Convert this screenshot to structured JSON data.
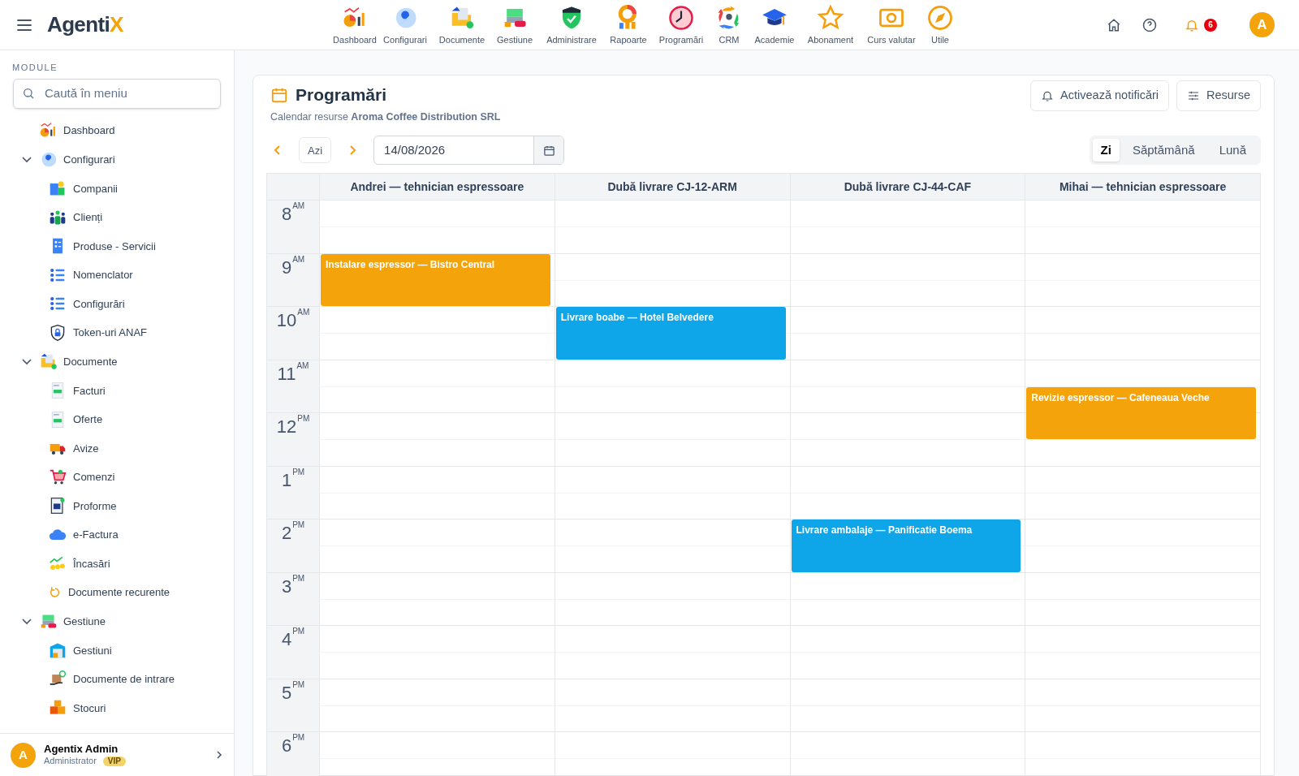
{
  "header": {
    "logo": {
      "text": "Agenti",
      "accent": "X"
    },
    "nav": [
      {
        "label": "Dashboard"
      },
      {
        "label": "Configurari"
      },
      {
        "label": "Documente"
      },
      {
        "label": "Gestiune"
      },
      {
        "label": "Administrare"
      },
      {
        "label": "Rapoarte"
      },
      {
        "label": "Programări"
      },
      {
        "label": "CRM"
      },
      {
        "label": "Academie"
      },
      {
        "label": "Abonament"
      },
      {
        "label": "Curs valutar"
      },
      {
        "label": "Utile"
      }
    ],
    "notifications": "6",
    "avatar": "A"
  },
  "sidebar": {
    "section": "MODULE",
    "search": {
      "placeholder": "Caută în meniu"
    },
    "items": [
      {
        "label": "Dashboard"
      },
      {
        "label": "Configurari",
        "expanded": true,
        "children": [
          {
            "label": "Companii"
          },
          {
            "label": "Clienți"
          },
          {
            "label": "Produse - Servicii"
          },
          {
            "label": "Nomenclator"
          },
          {
            "label": "Configurări"
          },
          {
            "label": "Token-uri ANAF"
          }
        ]
      },
      {
        "label": "Documente",
        "expanded": true,
        "children": [
          {
            "label": "Facturi"
          },
          {
            "label": "Oferte"
          },
          {
            "label": "Avize"
          },
          {
            "label": "Comenzi"
          },
          {
            "label": "Proforme"
          },
          {
            "label": "e-Factura"
          },
          {
            "label": "Încasări"
          },
          {
            "label": "Documente recurente"
          }
        ]
      },
      {
        "label": "Gestiune",
        "expanded": true,
        "children": [
          {
            "label": "Gestiuni"
          },
          {
            "label": "Documente de intrare"
          },
          {
            "label": "Stocuri"
          }
        ]
      }
    ],
    "user": {
      "avatar": "A",
      "name": "Agentix Admin",
      "role": "Administrator",
      "badge": "VIP"
    }
  },
  "page": {
    "title": "Programări",
    "subtitle": "Calendar resurse **Aroma Coffee Distribution SRL**",
    "buttons": [
      {
        "label": "Activează notificări"
      },
      {
        "label": "Resurse"
      }
    ],
    "today": "Azi",
    "date": "14/08/2026",
    "views": [
      {
        "label": "Zi",
        "selected": true
      },
      {
        "label": "Săptămână",
        "selected": false
      },
      {
        "label": "Lună",
        "selected": false
      }
    ]
  },
  "calendar": {
    "resources": [
      "Andrei — tehnician espressoare",
      "Dubă livrare CJ-12-ARM",
      "Dubă livrare CJ-44-CAF",
      "Mihai — tehnician espressoare"
    ],
    "hours": [
      "8$^{AM}$",
      "9$^{AM}$",
      "10$^{AM}$",
      "11$^{AM}$",
      "12$^{PM}$",
      "1$^{PM}$",
      "2$^{PM}$",
      "3$^{PM}$",
      "4$^{PM}$",
      "5$^{PM}$",
      "6$^{PM}$"
    ],
    "events": [
      {
        "title": "Instalare espressor — Bistro Central",
        "color": "#f5a30b"
      },
      {
        "title": "Livrare boabe — Hotel Belvedere",
        "color": "#0ea5e9"
      },
      {
        "title": "Revizie espressor — Cafeneaua Veche",
        "color": "#f5a30b"
      },
      {
        "title": "Livrare ambalaje — Panificatie Boema",
        "color": "#0ea5e9"
      }
    ]
  }
}
